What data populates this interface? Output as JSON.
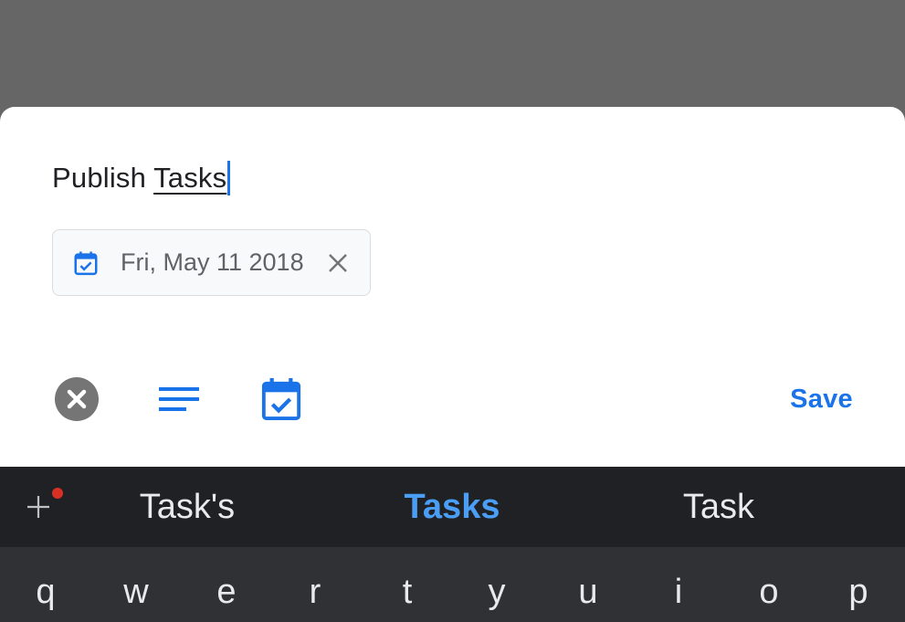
{
  "task_editor": {
    "title_prefix": "Publish",
    "title_word": "Tasks",
    "date_chip": {
      "label": "Fri, May 11 2018",
      "icon": "calendar-check-icon",
      "clear_icon": "close-icon"
    },
    "actions": {
      "cancel_icon": "cancel-circle-icon",
      "details_icon": "details-lines-icon",
      "date_icon": "calendar-check-icon",
      "save_label": "Save"
    }
  },
  "keyboard": {
    "suggestions": [
      "Task's",
      "Tasks",
      "Task"
    ],
    "selected_suggestion": "Tasks",
    "keys_row_1": [
      "q",
      "w",
      "e",
      "r",
      "t",
      "y",
      "u",
      "i",
      "o",
      "p"
    ]
  },
  "colors": {
    "accent": "#1a73e8",
    "suggestion_highlight": "#4a9ef5",
    "notification_dot": "#d93025",
    "scrim": "#666666",
    "keyboard_bg": "#303134"
  }
}
